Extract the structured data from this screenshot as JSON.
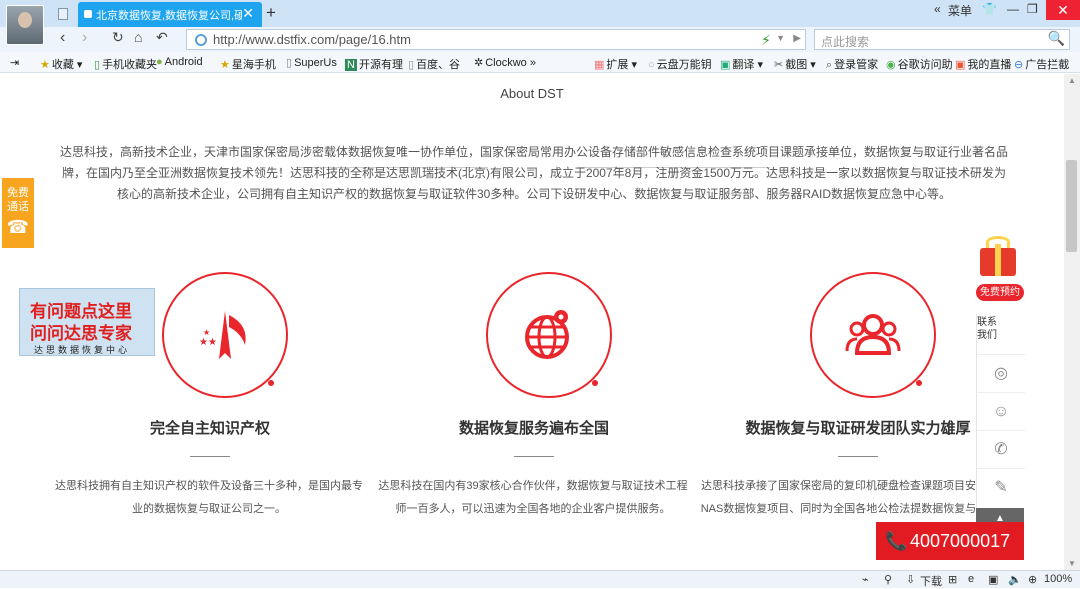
{
  "browser": {
    "tab_title": "北京数据恢复,数据恢复公司,硬盘",
    "tab_close": "✕",
    "new_tab": "+",
    "menu_label": "菜单",
    "url": "http://www.dstfix.com/page/16.htm",
    "search_placeholder": "点此搜索"
  },
  "bookmarks": [
    {
      "label": "收藏",
      "icon": "star-icon"
    },
    {
      "label": "手机收藏夹",
      "icon": "phone-icon"
    },
    {
      "label": "Android",
      "icon": "android-icon"
    },
    {
      "label": "星海手机",
      "icon": "star-icon"
    },
    {
      "label": "SuperUs",
      "icon": "page-icon"
    },
    {
      "label": "开源有理",
      "icon": "n-icon"
    },
    {
      "label": "百度、谷",
      "icon": "page-icon"
    },
    {
      "label": "Clockwo",
      "icon": "gear-icon"
    },
    {
      "label": "扩展",
      "icon": "grid-icon"
    },
    {
      "label": "云盘万能钥",
      "icon": "cloud-icon"
    },
    {
      "label": "翻译",
      "icon": "translate-icon"
    },
    {
      "label": "截图",
      "icon": "scissors-icon"
    },
    {
      "label": "登录管家",
      "icon": "search-icon"
    },
    {
      "label": "谷歌访问助",
      "icon": "chrome-icon"
    },
    {
      "label": "我的直播",
      "icon": "tv-icon"
    },
    {
      "label": "广告拦截",
      "icon": "block-icon"
    }
  ],
  "page": {
    "about_label": "About DST",
    "intro": "达思科技，高新技术企业，天津市国家保密局涉密载体数据恢复唯一协作单位，国家保密局常用办公设备存储部件敏感信息检查系统项目课题承接单位，数据恢复与取证行业著名品牌，在国内乃至全亚洲数据恢复技术领先！达思科技的全称是达思凯瑞技术(北京)有限公司，成立于2007年8月，注册资金1500万元。达思科技是一家以数据恢复与取证技术研发为核心的高新技术企业，公司拥有自主知识产权的数据恢复与取证软件30多种。公司下设研发中心、数据恢复与取证服务部、服务器RAID数据恢复应急中心等。",
    "features": [
      {
        "title": "完全自主知识产权",
        "desc": "达思科技拥有自主知识产权的软件及设备三十多种，是国内最专业的数据恢复与取证公司之一。"
      },
      {
        "title": "数据恢复服务遍布全国",
        "desc": "达思科技在国内有39家核心合作伙伴，数据恢复与取证技术工程师一百多人，可以迅速为全国各地的企业客户提供服务。"
      },
      {
        "title": "数据恢复与取证研发团队实力雄厚",
        "desc": "达思科技承接了国家保密局的复印机硬盘检查课题项目安全局的NAS数据恢复项目、同时为全国各地公检法提数据恢复与取证技"
      }
    ]
  },
  "widgets": {
    "free_call": "免费通话",
    "ask_line1": "有问题点这里",
    "ask_line2": "问问达思专家",
    "ask_line3": "达思数据恢复中心",
    "free_booking": "免费预约",
    "contact_us": "联系我们",
    "hotline": "4007000017"
  },
  "status": {
    "download": "下载",
    "zoom": "100%"
  },
  "colors": {
    "accent": "#e8262b",
    "tab": "#1ea4ef"
  }
}
